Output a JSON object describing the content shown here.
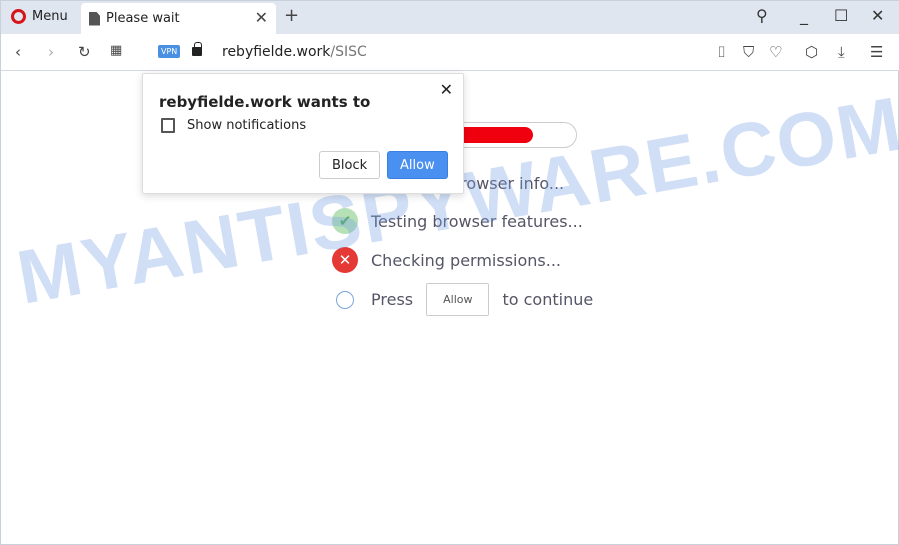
{
  "browser": {
    "menu_label": "Menu",
    "tab_title": "Please wait",
    "url_domain": "rebyfielde.work",
    "url_path": "/SISC",
    "vpn_badge": "VPN"
  },
  "popup": {
    "title": "rebyfielde.work wants to",
    "permission": "Show notifications",
    "block_label": "Block",
    "allow_label": "Allow"
  },
  "page": {
    "progress_percent": 83,
    "steps": [
      {
        "text": "Checking browser info...",
        "status": "hidden"
      },
      {
        "text": "Testing browser features...",
        "status": "success"
      },
      {
        "text": "Checking permissions...",
        "status": "error"
      }
    ],
    "press_label": "Press",
    "allow_button": "Allow",
    "continue_label": "to continue"
  },
  "watermark": "MYANTISPYWARE.COM",
  "colors": {
    "progress": "#f0000f",
    "allow": "#4a90f0"
  }
}
